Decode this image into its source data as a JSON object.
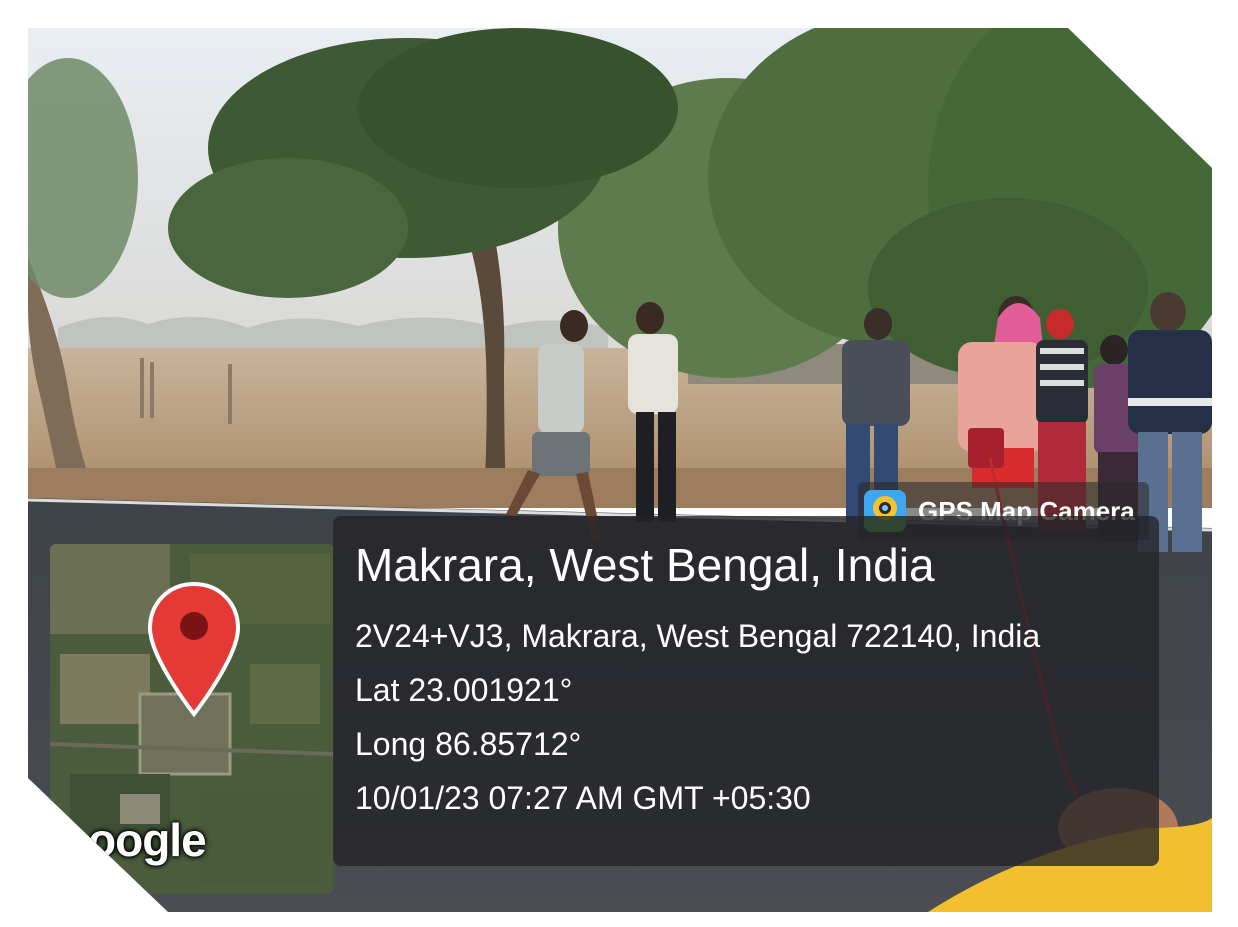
{
  "overlay": {
    "app_badge": "GPS Map Camera",
    "location_title": "Makrara, West Bengal, India",
    "address": "2V24+VJ3, Makrara, West Bengal 722140, India",
    "latitude": "Lat 23.001921°",
    "longitude": "Long 86.85712°",
    "datetime": "10/01/23 07:27 AM GMT +05:30",
    "map_attribution": "oogle"
  },
  "icons": {
    "map_marker": "map-pin-icon",
    "app_logo": "camera-globe-icon"
  },
  "colors": {
    "pin_red": "#e53935",
    "card_bg": "#232326",
    "badge_blue": "#3da7ef"
  }
}
